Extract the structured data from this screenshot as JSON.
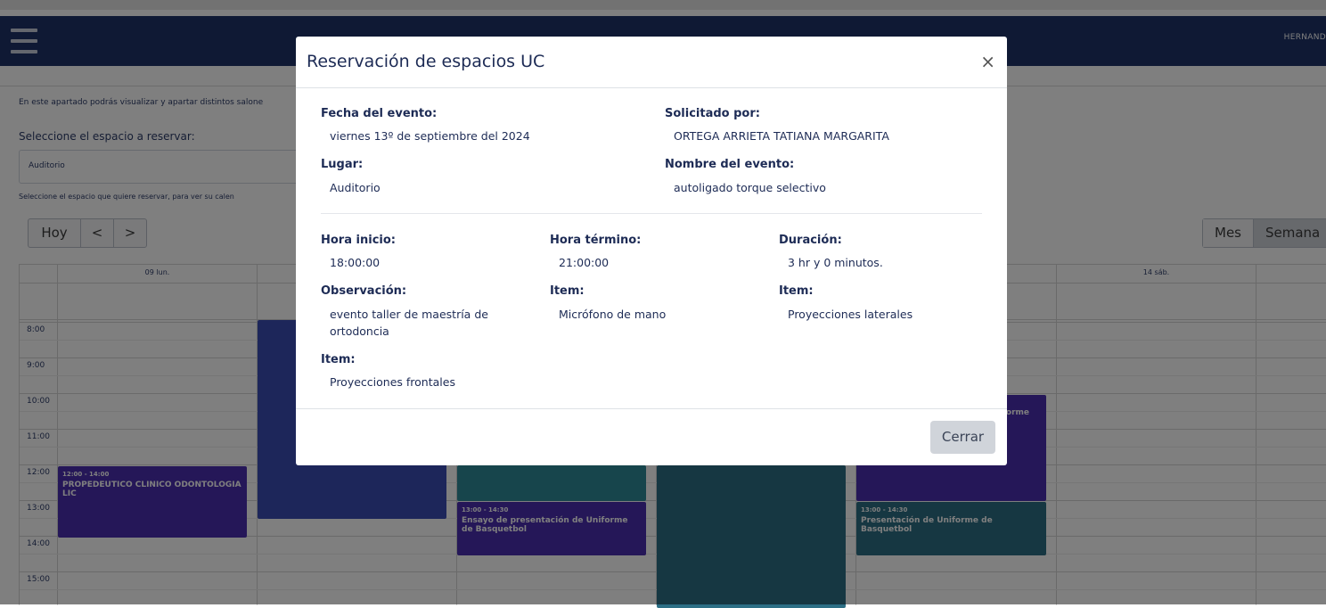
{
  "navbar": {
    "user_name": "HERNAND"
  },
  "page": {
    "intro": "En este apartado podrás visualizar y apartar distintos salone",
    "select_label": "Seleccione el espacio a reservar:",
    "select_value": "Auditorio",
    "select_hint": "Seleccione el espacio que quiere reservar, para ver su calen"
  },
  "calendar": {
    "today_label": "Hoy",
    "prev_label": "<",
    "next_label": ">",
    "view_month": "Mes",
    "view_week": "Semana",
    "day_headers": [
      "09 lun.",
      "14 sáb."
    ],
    "times": [
      "8:00",
      "9:00",
      "10:00",
      "11:00",
      "12:00",
      "13:00",
      "14:00",
      "15:00"
    ],
    "events": [
      {
        "time": "12:00 - 14:00",
        "title": "PROPEDEUTICO CLINICO ODONTOLOGIA LIC"
      },
      {
        "time": "13:00 - 14:30",
        "title": "Ensayo de presentación de Uniforme de Basquetbol"
      },
      {
        "time": "13:00 - 14:30",
        "title": "Presentación de Uniforme de Basquetbol"
      },
      {
        "title": "forme"
      }
    ]
  },
  "modal": {
    "title": "Reservación de espacios UC",
    "close_icon": "×",
    "fecha_label": "Fecha del evento:",
    "fecha_value": "viernes 13º de septiembre del 2024",
    "solicitado_label": "Solicitado por:",
    "solicitado_value": "ORTEGA ARRIETA TATIANA MARGARITA",
    "lugar_label": "Lugar:",
    "lugar_value": "Auditorio",
    "nombre_label": "Nombre del evento:",
    "nombre_value": "autoligado torque selectivo",
    "inicio_label": "Hora inicio:",
    "inicio_value": "18:00:00",
    "termino_label": "Hora término:",
    "termino_value": "21:00:00",
    "duracion_label": "Duración:",
    "duracion_value": "3 hr y 0 minutos.",
    "observacion_label": "Observación:",
    "observacion_value": "evento taller de maestría de ortodoncia",
    "item1_label": "Item:",
    "item1_value": "Micrófono de mano",
    "item2_label": "Item:",
    "item2_value": "Proyecciones laterales",
    "item3_label": "Item:",
    "item3_value": "Proyecciones frontales",
    "close_button": "Cerrar"
  },
  "colors": {
    "navbar": "#1e3368",
    "event_purple": "#4b2fb0",
    "event_blue": "#3a4db4",
    "event_teal": "#2f8a98",
    "event_dark_teal": "#2d6f85"
  }
}
